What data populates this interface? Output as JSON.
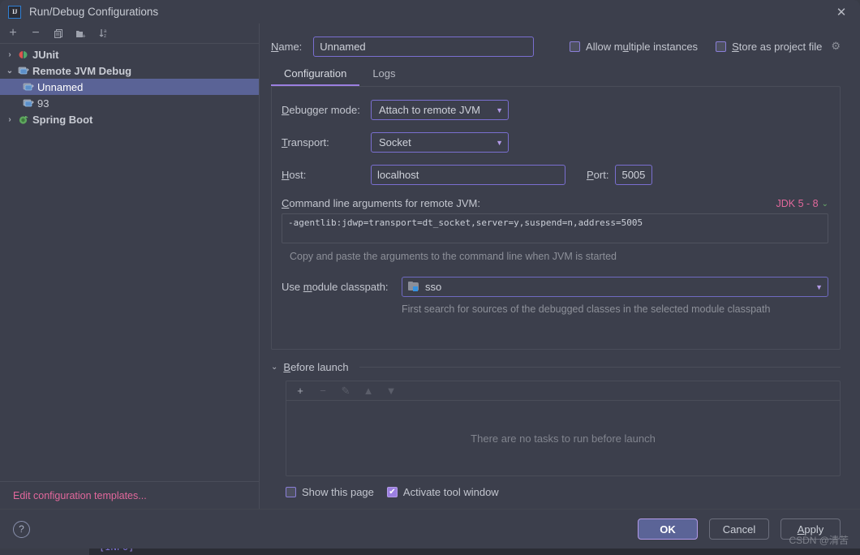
{
  "window": {
    "title": "Run/Debug Configurations",
    "logo_text": "IJ",
    "close_icon": "✕"
  },
  "tree_toolbar": {
    "add_icon": "+",
    "remove_icon": "−",
    "copy_icon": "❐",
    "folder_icon": "🗀",
    "sort_icon": "↓"
  },
  "tree": {
    "items": [
      {
        "label": "JUnit",
        "chevron": "›",
        "icon": "junit-icon",
        "level": 0,
        "selected": false,
        "bold": true
      },
      {
        "label": "Remote JVM Debug",
        "chevron": "⌄",
        "icon": "remote-debug-icon",
        "level": 0,
        "selected": false,
        "bold": true
      },
      {
        "label": "Unnamed",
        "chevron": "",
        "icon": "remote-debug-icon",
        "level": 1,
        "selected": true,
        "bold": false
      },
      {
        "label": "93",
        "chevron": "",
        "icon": "remote-debug-icon",
        "level": 1,
        "selected": false,
        "bold": false
      },
      {
        "label": "Spring Boot",
        "chevron": "›",
        "icon": "spring-boot-icon",
        "level": 0,
        "selected": false,
        "bold": true
      }
    ],
    "edit_templates_label": "Edit configuration templates..."
  },
  "header": {
    "name_label": "Name:",
    "name_value": "Unnamed",
    "allow_multiple_label": "Allow multiple instances",
    "allow_multiple_checked": false,
    "store_project_file_label": "Store as project file",
    "store_project_file_checked": false,
    "gear_icon": "⚙"
  },
  "tabs": [
    {
      "label": "Configuration",
      "active": true
    },
    {
      "label": "Logs",
      "active": false
    }
  ],
  "configuration": {
    "debugger_mode_label": "Debugger mode:",
    "debugger_mode_value": "Attach to remote JVM",
    "transport_label": "Transport:",
    "transport_value": "Socket",
    "host_label": "Host:",
    "host_value": "localhost",
    "port_label": "Port:",
    "port_value": "5005",
    "cmdline_label": "Command line arguments for remote JVM:",
    "jdk_selector_label": "JDK 5 - 8",
    "cmdline_value": "-agentlib:jdwp=transport=dt_socket,server=y,suspend=n,address=5005",
    "cmdline_hint": "Copy and paste the arguments to the command line when JVM is started",
    "classpath_label": "Use module classpath:",
    "classpath_value": "sso",
    "classpath_hint": "First search for sources of the debugged classes in the selected module classpath",
    "dropdown_arrow": "▼"
  },
  "before_launch": {
    "title": "Before launch",
    "chevron": "⌄",
    "toolbar": {
      "add_icon": "+",
      "remove_icon": "−",
      "edit_icon": "✎",
      "up_icon": "▲",
      "down_icon": "▼"
    },
    "empty_text": "There are no tasks to run before launch",
    "show_page_label": "Show this page",
    "show_page_checked": false,
    "activate_tool_window_label": "Activate tool window",
    "activate_tool_window_checked": true
  },
  "footer": {
    "help_icon": "?",
    "ok_label": "OK",
    "cancel_label": "Cancel",
    "apply_label": "Apply",
    "watermark": "CSDN @清苦"
  },
  "background_console": {
    "bracket_open": "[",
    "level": "INFO",
    "bracket_close": "]",
    "dashes": "- - - - - - - - - - - - - - - - - - - - - - - - - - - - - - - - - - - - - - - - - - - - - - - - - - - - - - - - - - - - - - - - - - - - - - -"
  },
  "colors": {
    "accent_purple": "#9b7fe0",
    "link_pink": "#e2689c",
    "selection_blue": "#5a6396",
    "dialog_bg": "#3c3f4c"
  }
}
